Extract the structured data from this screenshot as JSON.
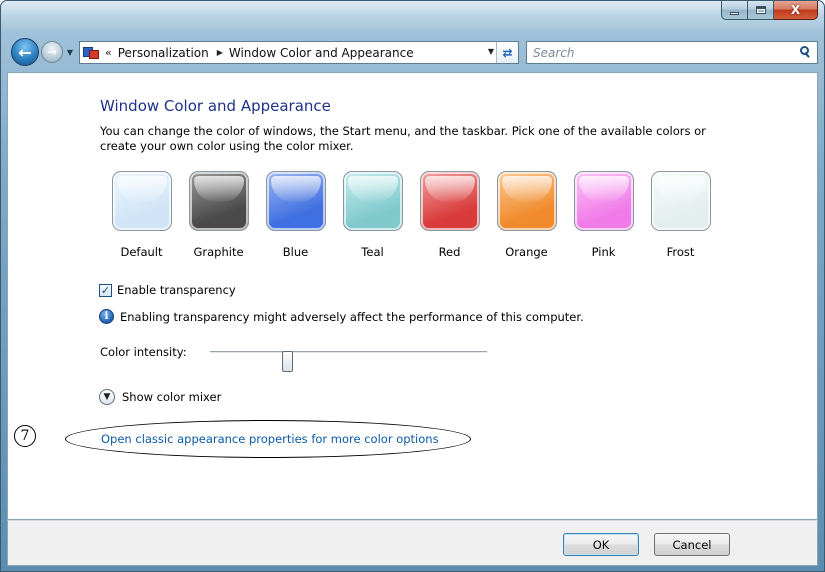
{
  "window": {
    "caption": {
      "minimize": "",
      "maximize": "",
      "close": "X"
    }
  },
  "navbar": {
    "breadcrumb_separator": "«",
    "breadcrumb": [
      "Personalization",
      "Window Color and Appearance"
    ],
    "search_placeholder": "Search"
  },
  "content": {
    "title": "Window Color and Appearance",
    "description": "You can change the color of windows, the Start menu, and the taskbar. Pick one of the available colors or create your own color using the color mixer.",
    "swatches": [
      {
        "label": "Default",
        "color": "#cfe4f7",
        "accent": "#eef6fd"
      },
      {
        "label": "Graphite",
        "color": "#4a4a4a",
        "accent": "#9a9a9a"
      },
      {
        "label": "Blue",
        "color": "#3f6fe0",
        "accent": "#9db7f2"
      },
      {
        "label": "Teal",
        "color": "#7fc9cc",
        "accent": "#c7ecee"
      },
      {
        "label": "Red",
        "color": "#d93b3b",
        "accent": "#f2a0a0"
      },
      {
        "label": "Orange",
        "color": "#f08a2c",
        "accent": "#fbc994"
      },
      {
        "label": "Pink",
        "color": "#f07be8",
        "accent": "#fbc3f7"
      },
      {
        "label": "Frost",
        "color": "#e4eeee",
        "accent": "#f7fbfb"
      }
    ],
    "transparency": {
      "label": "Enable transparency",
      "checked": true
    },
    "info_text": "Enabling transparency might adversely affect the performance of this computer.",
    "intensity": {
      "label": "Color intensity:",
      "value": 0.27
    },
    "mixer_label": "Show color mixer",
    "classic_link": "Open classic appearance properties for more color options",
    "annotation_number": "7"
  },
  "footer": {
    "ok": "OK",
    "cancel": "Cancel"
  }
}
